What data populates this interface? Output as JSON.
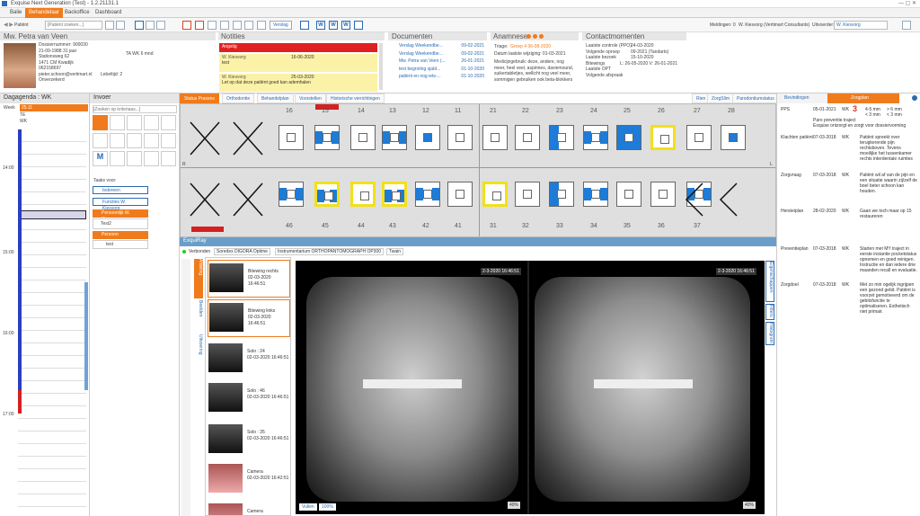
{
  "app": {
    "title": "Exquise Next Generation (Test) - 1.2.21131.1"
  },
  "menu": {
    "items": [
      "Balie",
      "Behandelaar",
      "Backoffice",
      "Dashboard"
    ],
    "active": "Behandelaar"
  },
  "toolbar": {
    "search_placeholder": "[Patiënt zoeken...]",
    "patient_label": "Patiënt",
    "verslag_label": "Verslag",
    "meldingen": "Meldingen: 0",
    "user": "W. Kiesvorg (Vertimart Consultants)",
    "uitvoerder_label": "Uitvoerder:",
    "uitvoerder_value": "W. Kiesvorg"
  },
  "patient": {
    "name": "Mw. Petra van Veen",
    "lines": [
      "Dossiernummer: 900030",
      "21-09-1988 31 jaar",
      "Stationsweg 62",
      "1471 CM Kwadijk",
      "062158697",
      "pieter.schoon@vertimart.nl",
      "Onverzekerd"
    ],
    "lebeltijd": "Lebeltijd: 2",
    "ta": "TA  WK  6 mnd"
  },
  "notities": {
    "title": "Notities",
    "items": [
      {
        "title": "Angstig",
        "color": "#e02020",
        "text": ""
      },
      {
        "title": "W. Kiesvorg",
        "date": "16-06-2020",
        "text": "test"
      },
      {
        "title": "W. Kiesvorg",
        "date": "25-03-2020",
        "text": "Let op dat deze patiënt goed kan ademhalen"
      }
    ]
  },
  "documenten": {
    "title": "Documenten",
    "items": [
      {
        "name": "Verslag Weekendbe...",
        "date": "09-02-2021"
      },
      {
        "name": "Verslag Weekendbe...",
        "date": "09-02-2021"
      },
      {
        "name": "Mw. Petra van Veen (...",
        "date": "26-01-2021"
      },
      {
        "name": "test begroting sjabl...",
        "date": "01-10-2020"
      },
      {
        "name": "patiënt en nog iets-...",
        "date": "01-10-2020"
      }
    ]
  },
  "anamnese": {
    "title": "Anamnese",
    "triage_label": "Triage:",
    "triage_value": "Groep 4 06-08-2020",
    "laatste": "Datum laatste wijziging: 01-03-2021",
    "text": "Medicijngebruik: deze, andere, nog meer, heel veel, aspirines, daviemound, suikertabletjes, wellicht nog veel meer, sommigen gebruiken ook beta-blokkers"
  },
  "contact": {
    "title": "Contactmomenten",
    "rows": [
      {
        "k": "Laatste controle (PPO)",
        "v": "24-03-2020"
      },
      {
        "k": "Volgende oproep",
        "v": "09-2021 (Tandarts)"
      },
      {
        "k": "Laatste bezoek",
        "v": "15-10-2020"
      },
      {
        "k": "Bitewings",
        "v": "L: 26-05-2020   V: 26-01-2021"
      },
      {
        "k": "Laatste OPT",
        "v": ""
      },
      {
        "k": "Volgende afspraak",
        "v": ""
      }
    ]
  },
  "dagagenda": {
    "title": "Dagagenda : WK",
    "week_label": "Week",
    "week_value": "25.11",
    "rows": [
      "TE",
      "WK"
    ],
    "times": [
      "14:00",
      "15:00",
      "16:00",
      "17:00"
    ]
  },
  "invoer": {
    "title": "Invoer",
    "search_placeholder": "[Zoeken op kriteriaas...]",
    "taaks_label": "Taaks voor:",
    "buttons": [
      "Iedereen",
      "Functies W. Kiesvorg",
      "Persoonlijk W. Kiesvorg"
    ],
    "list": [
      "Test2",
      "Persoon",
      "test"
    ]
  },
  "chart_tabs": {
    "items": [
      "Status Praxens",
      "Orthodontie",
      "Behandelplan",
      "Voorstellen",
      "Historische verrichtingen"
    ],
    "right": [
      "Rien",
      "ZorgSlim",
      "Parodontiumstatus"
    ]
  },
  "right_tabs": {
    "items": [
      "Bevindingen",
      "Zorgplan"
    ]
  },
  "teeth": {
    "upper": [
      "16",
      "15",
      "14",
      "13",
      "12",
      "11",
      "21",
      "22",
      "23",
      "24",
      "25",
      "26",
      "27",
      "28"
    ],
    "lower": [
      "46",
      "45",
      "44",
      "43",
      "42",
      "41",
      "31",
      "32",
      "33",
      "34",
      "35",
      "36",
      "37"
    ],
    "letters": {
      "r": "R",
      "l": "L"
    }
  },
  "exquiray": {
    "title": "ExquiRay",
    "connected": "Verbonden",
    "device1": "Soredex DIGORA Optime",
    "device2": "Instrumentarium ORTHOPANTOMOGRAPH OP300",
    "device3": "Twain",
    "thumbs": [
      {
        "label": "Bitewing rechts",
        "date": "02-03-2020 16:46:51"
      },
      {
        "label": "Bitewing links",
        "date": "02-03-2020 16:46:51"
      },
      {
        "label": "Solo : 24",
        "date": "02-03-2020 16:46:51"
      },
      {
        "label": "Solo : 46",
        "date": "02-03-2020 16:46:51"
      },
      {
        "label": "Solo : 35",
        "date": "02-03-2020 16:46:51"
      },
      {
        "label": "Camera",
        "date": "02-03-2020 16:42:51"
      },
      {
        "label": "Camera",
        "date": ""
      }
    ],
    "date1": "2-3-2020 16:46:51",
    "date2": "2-3-2020 16:46:51",
    "zoom1": "40%",
    "zoom2": "40%",
    "vullen": "Vullen",
    "pct100": "100%",
    "side_tabs": [
      "Afdeling",
      "Beelden",
      "Uitvoering"
    ],
    "right_tabs": [
      "Eigenschappen",
      "Filters",
      "Histogram"
    ]
  },
  "zorgplan": {
    "pps": {
      "label": "PPS",
      "date": "05-01-2021",
      "by": "WK",
      "value": "3",
      "legend": [
        "4-5 mm",
        "> 6 mm",
        "< 3 mm",
        "< 3 mm"
      ],
      "title": "Paro preventie traject",
      "text": "Exquise ontzorgt en zorgt voor dossiervorming"
    },
    "entries": [
      {
        "k": "Klachten patiënt",
        "date": "07-03-2018",
        "by": "WK",
        "text": "Patiënt spreekt over terugkerende pijn rechtsboven. Tevens moeilijke het tussenkamer rechts interdentale ruimtes"
      },
      {
        "k": "Zorgvraag",
        "date": "07-03-2018",
        "by": "WK",
        "text": "Patiënt wil af van de pijn en een situatie waarin zij/zelf de boel beter schoon kan houden."
      },
      {
        "k": "Hersteiplan",
        "date": "28-02-2020",
        "by": "WK",
        "text": "Gaan we toch maar op 15 restaureren"
      },
      {
        "k": "Preventieplan",
        "date": "07-03-2018",
        "by": "WK",
        "text": "Starten met MY traject in eerste instantie pocketstatus opnemen en goed reinigen. Instructie en dan iedere drie maanden recall en evaluatie."
      },
      {
        "k": "Zorgdoel",
        "date": "07-03-2018",
        "by": "WK",
        "text": "Met zo min ogelijk ingrijpen een gezond gebit. Patiënt is voorzet gemotiveerd om de gebitsfunctie te optimaliseren. Esthetisch niet primair."
      }
    ]
  },
  "colors": {
    "accent": "#f07b1c",
    "blue": "#2a6ab5",
    "tooth_blue": "#1e7bd6",
    "yellow": "#f2e01a",
    "red": "#d32020"
  }
}
